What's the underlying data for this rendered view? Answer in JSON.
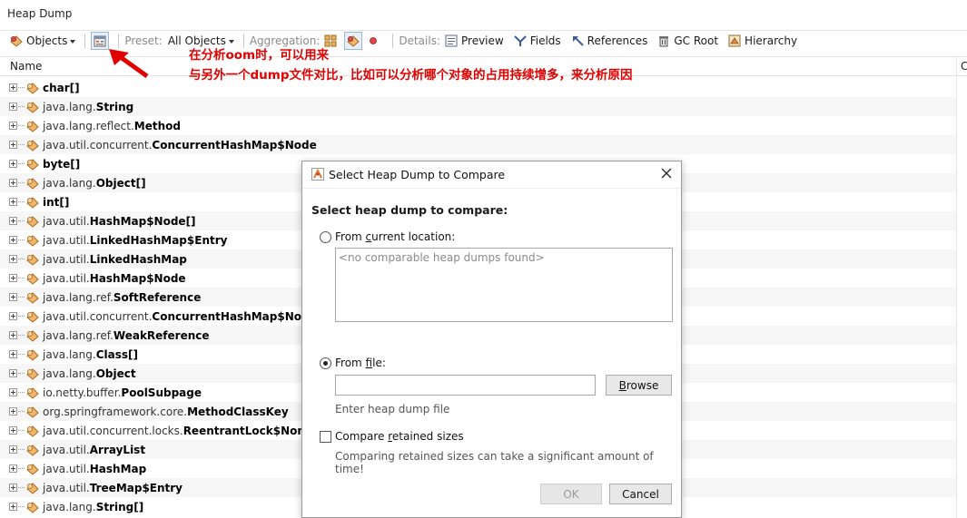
{
  "window": {
    "tab_title": "Heap Dump"
  },
  "toolbar": {
    "view_label": "Objects",
    "preset_label": "Preset:",
    "preset_value": "All Objects",
    "aggregation_label": "Aggregation:",
    "details_label": "Details:",
    "preview": "Preview",
    "fields": "Fields",
    "references": "References",
    "gc_root": "GC Root",
    "hierarchy": "Hierarchy"
  },
  "table": {
    "name_header": "Name",
    "other_header": "C",
    "rows": [
      {
        "pkg": "",
        "cls": "char[]"
      },
      {
        "pkg": "java.lang.",
        "cls": "String"
      },
      {
        "pkg": "java.lang.reflect.",
        "cls": "Method"
      },
      {
        "pkg": "java.util.concurrent.",
        "cls": "ConcurrentHashMap$Node"
      },
      {
        "pkg": "",
        "cls": "byte[]"
      },
      {
        "pkg": "java.lang.",
        "cls": "Object[]"
      },
      {
        "pkg": "",
        "cls": "int[]"
      },
      {
        "pkg": "java.util.",
        "cls": "HashMap$Node[]"
      },
      {
        "pkg": "java.util.",
        "cls": "LinkedHashMap$Entry"
      },
      {
        "pkg": "java.util.",
        "cls": "LinkedHashMap"
      },
      {
        "pkg": "java.util.",
        "cls": "HashMap$Node"
      },
      {
        "pkg": "java.lang.ref.",
        "cls": "SoftReference"
      },
      {
        "pkg": "java.util.concurrent.",
        "cls": "ConcurrentHashMap$Node[]"
      },
      {
        "pkg": "java.lang.ref.",
        "cls": "WeakReference"
      },
      {
        "pkg": "java.lang.",
        "cls": "Class[]"
      },
      {
        "pkg": "java.lang.",
        "cls": "Object"
      },
      {
        "pkg": "io.netty.buffer.",
        "cls": "PoolSubpage"
      },
      {
        "pkg": "org.springframework.core.",
        "cls": "MethodClassKey"
      },
      {
        "pkg": "java.util.concurrent.locks.",
        "cls": "ReentrantLock$Nonfair"
      },
      {
        "pkg": "java.util.",
        "cls": "ArrayList"
      },
      {
        "pkg": "java.util.",
        "cls": "HashMap"
      },
      {
        "pkg": "java.util.",
        "cls": "TreeMap$Entry"
      },
      {
        "pkg": "java.lang.",
        "cls": "String[]"
      }
    ]
  },
  "annotation": {
    "line1": "在分析oom时，可以用来",
    "line2": "与另外一个dump文件对比，比如可以分析哪个对象的占用持续增多，来分析原因",
    "color": "#e00000"
  },
  "dialog": {
    "title": "Select Heap Dump to Compare",
    "heading": "Select heap dump to compare:",
    "from_current_prefix": "From ",
    "from_current_underlined": "c",
    "from_current_suffix": "urrent location:",
    "no_dumps_placeholder": "<no comparable heap dumps found>",
    "from_file_prefix": "From ",
    "from_file_underlined": "f",
    "from_file_suffix": "ile:",
    "file_value": "",
    "browse_underlined": "B",
    "browse_suffix": "rowse",
    "file_hint": "Enter heap dump file",
    "compare_prefix": "Compare ",
    "compare_underlined": "r",
    "compare_suffix": "etained sizes",
    "compare_hint": "Comparing retained sizes can take a significant amount of time!",
    "ok": "OK",
    "cancel": "Cancel"
  }
}
